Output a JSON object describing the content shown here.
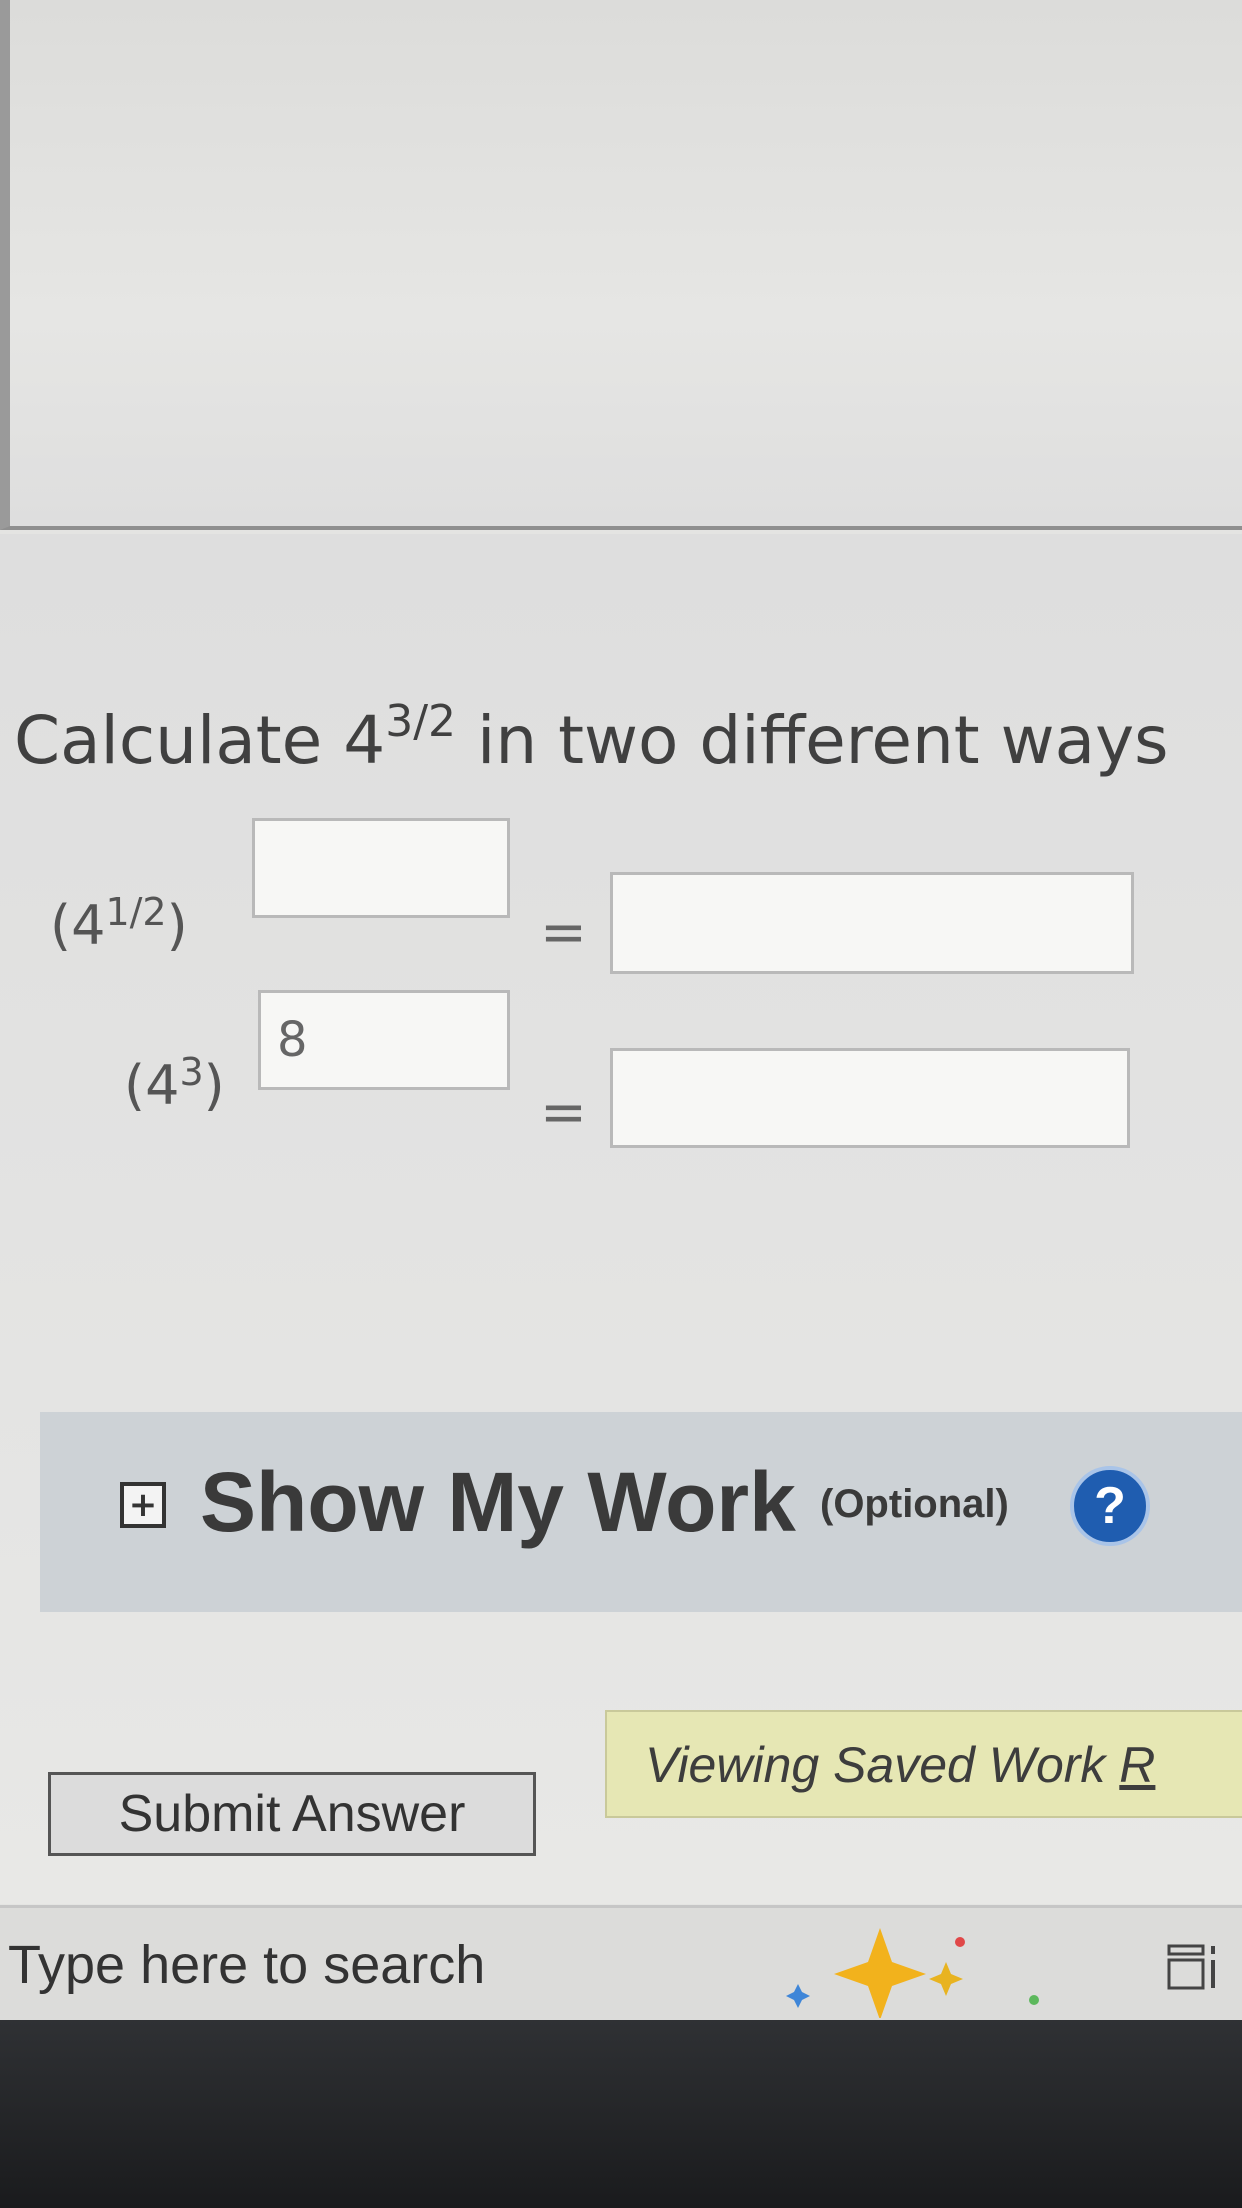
{
  "question": {
    "prefix": "Calculate 4",
    "exponent": "3/2",
    "suffix": " in two different ways"
  },
  "row1": {
    "base_open": "(4",
    "base_exp": "1/2",
    "base_close": ")",
    "exponent_value": "",
    "equals": "=",
    "result_value": ""
  },
  "row2": {
    "base_open": "(4",
    "base_exp": "3",
    "base_close": ")",
    "exponent_value": "8",
    "equals": "=",
    "result_value": ""
  },
  "work_panel": {
    "title": "Show My Work",
    "optional": "(Optional)",
    "help_symbol": "?",
    "expand_symbol": "+"
  },
  "saved": {
    "text": "Viewing Saved Work ",
    "link": "R"
  },
  "submit": {
    "label": "Submit Answer"
  },
  "taskbar": {
    "search_placeholder": "Type here to search"
  },
  "colors": {
    "help_icon": "#1f5db0",
    "saved_bar": "#e6e7b4",
    "work_panel": "#cdd2d6"
  }
}
